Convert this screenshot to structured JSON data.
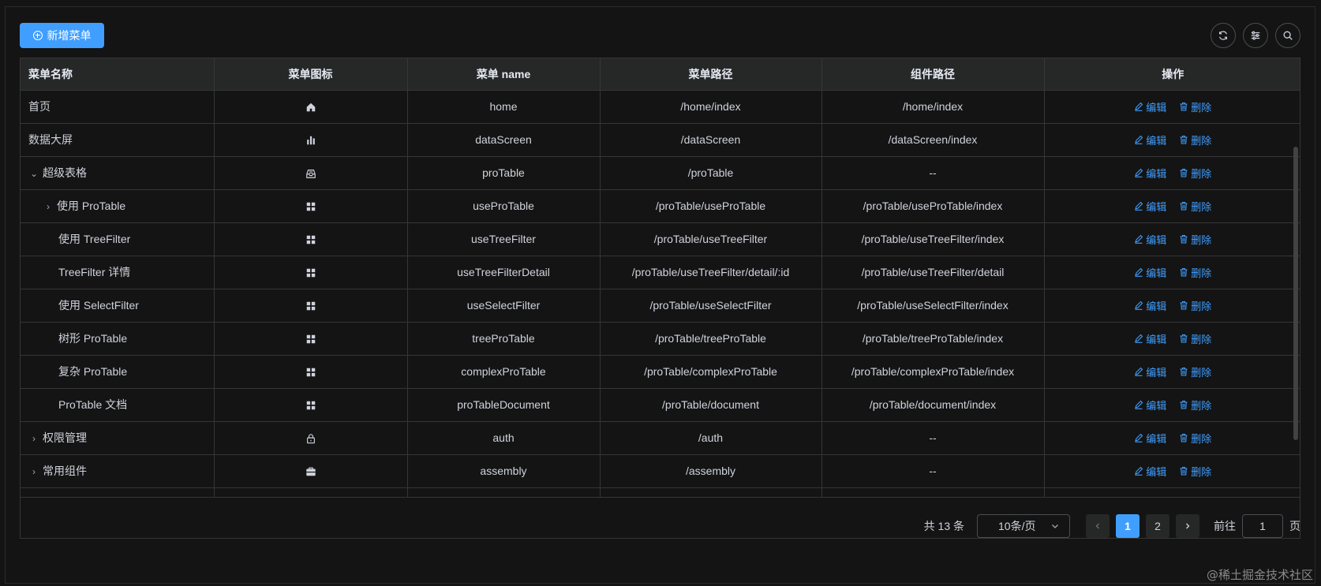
{
  "toolbar": {
    "add_label": "新增菜单"
  },
  "columns": [
    "菜单名称",
    "菜单图标",
    "菜单 name",
    "菜单路径",
    "组件路径",
    "操作"
  ],
  "rows": [
    {
      "label": "首页",
      "icon": "home-icon",
      "name": "home",
      "path": "/home/index",
      "component": "/home/index",
      "level": 0,
      "expander": ""
    },
    {
      "label": "数据大屏",
      "icon": "histogram-icon",
      "name": "dataScreen",
      "path": "/dataScreen",
      "component": "/dataScreen/index",
      "level": 0,
      "expander": ""
    },
    {
      "label": "超级表格",
      "icon": "message-box-icon",
      "name": "proTable",
      "path": "/proTable",
      "component": "--",
      "level": 0,
      "expander": "expanded"
    },
    {
      "label": "使用 ProTable",
      "icon": "menu-icon",
      "name": "useProTable",
      "path": "/proTable/useProTable",
      "component": "/proTable/useProTable/index",
      "level": 1,
      "expander": "collapsed"
    },
    {
      "label": "使用 TreeFilter",
      "icon": "menu-icon",
      "name": "useTreeFilter",
      "path": "/proTable/useTreeFilter",
      "component": "/proTable/useTreeFilter/index",
      "level": 1,
      "expander": ""
    },
    {
      "label": "TreeFilter 详情",
      "icon": "menu-icon",
      "name": "useTreeFilterDetail",
      "path": "/proTable/useTreeFilter/detail/:id",
      "component": "/proTable/useTreeFilter/detail",
      "level": 1,
      "expander": ""
    },
    {
      "label": "使用 SelectFilter",
      "icon": "menu-icon",
      "name": "useSelectFilter",
      "path": "/proTable/useSelectFilter",
      "component": "/proTable/useSelectFilter/index",
      "level": 1,
      "expander": ""
    },
    {
      "label": "树形 ProTable",
      "icon": "menu-icon",
      "name": "treeProTable",
      "path": "/proTable/treeProTable",
      "component": "/proTable/treeProTable/index",
      "level": 1,
      "expander": ""
    },
    {
      "label": "复杂 ProTable",
      "icon": "menu-icon",
      "name": "complexProTable",
      "path": "/proTable/complexProTable",
      "component": "/proTable/complexProTable/index",
      "level": 1,
      "expander": ""
    },
    {
      "label": "ProTable 文档",
      "icon": "menu-icon",
      "name": "proTableDocument",
      "path": "/proTable/document",
      "component": "/proTable/document/index",
      "level": 1,
      "expander": ""
    },
    {
      "label": "权限管理",
      "icon": "lock-icon",
      "name": "auth",
      "path": "/auth",
      "component": "--",
      "level": 0,
      "expander": "collapsed"
    },
    {
      "label": "常用组件",
      "icon": "briefcase-icon",
      "name": "assembly",
      "path": "/assembly",
      "component": "--",
      "level": 0,
      "expander": "collapsed"
    }
  ],
  "actions": {
    "edit": "编辑",
    "delete": "删除"
  },
  "pagination": {
    "total_text": "共 13 条",
    "page_size": "10条/页",
    "pages": [
      "1",
      "2"
    ],
    "current_page": "1",
    "goto_prefix": "前往",
    "goto_value": "1",
    "goto_suffix": "页"
  },
  "watermark": "@稀土掘金技术社区",
  "colors": {
    "accent": "#409eff",
    "background": "#141414",
    "header_bg": "#262727",
    "border": "#363637"
  }
}
